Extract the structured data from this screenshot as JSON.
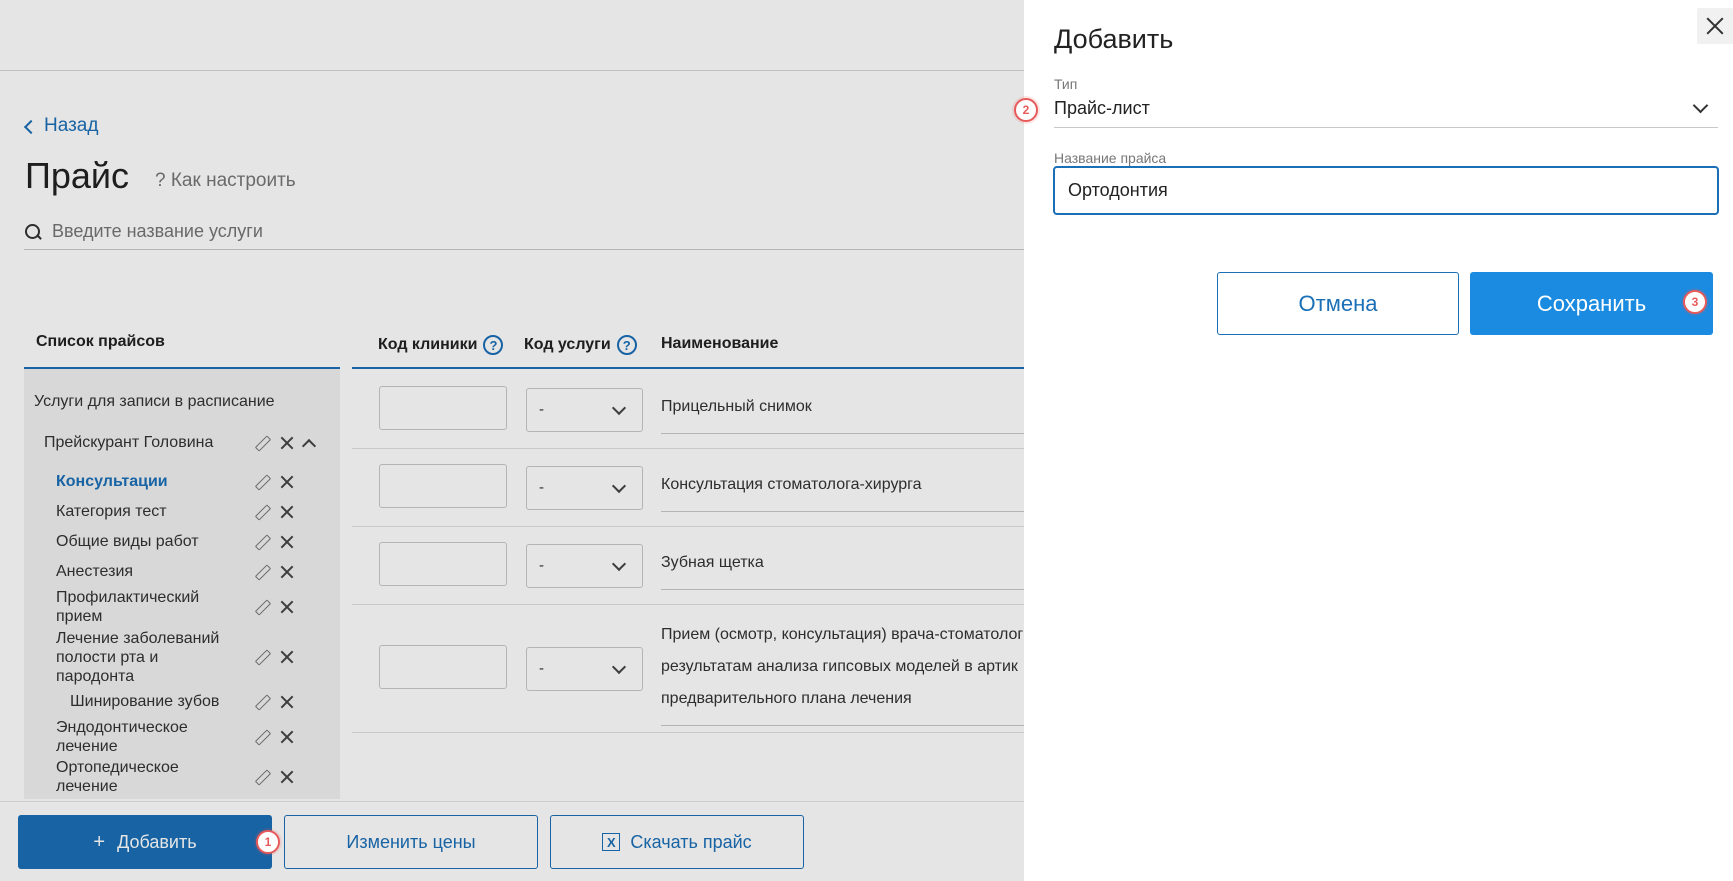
{
  "page": {
    "back_label": "Назад",
    "title": "Прайс",
    "howto_label": "? Как настроить",
    "search_placeholder": "Введите название услуги"
  },
  "price_list": {
    "header": "Список прайсов",
    "root": "Услуги для записи в расписание",
    "group": "Прейскурант Головина",
    "items": [
      {
        "label": "Консультации",
        "active": true
      },
      {
        "label": "Категория тест"
      },
      {
        "label": "Общие виды работ"
      },
      {
        "label": "Анестезия"
      },
      {
        "label": "Профилактический прием"
      },
      {
        "label": "Лечение заболеваний полости рта и пародонта"
      },
      {
        "label": "Шинирование зубов"
      },
      {
        "label": "Эндодонтическое лечение"
      },
      {
        "label": "Ортопедическое лечение"
      }
    ]
  },
  "table": {
    "col_clinic_code": "Код клиники",
    "col_service_code": "Код услуги",
    "col_name": "Наименование",
    "rows": [
      {
        "service_code": "-",
        "name": "Прицельный снимок"
      },
      {
        "service_code": "-",
        "name": "Консультация стоматолога-хирурга"
      },
      {
        "service_code": "-",
        "name": "Зубная щетка"
      },
      {
        "service_code": "-",
        "name_lines": [
          "Прием (осмотр, консультация) врача-стоматолог",
          "результатам анализа гипсовых моделей в артик",
          "предварительного плана лечения"
        ]
      }
    ]
  },
  "actions": {
    "add": "Добавить",
    "change_prices": "Изменить цены",
    "download": "Скачать прайс"
  },
  "drawer": {
    "title": "Добавить",
    "type_label": "Тип",
    "type_value": "Прайс-лист",
    "name_label": "Название прайса",
    "name_value": "Ортодонтия",
    "cancel": "Отмена",
    "save": "Сохранить"
  },
  "steps": [
    "1",
    "2",
    "3"
  ],
  "colors": {
    "accent": "#1a6fb7",
    "save_button": "#1a8be0",
    "step_marker": "#e85a5a"
  }
}
